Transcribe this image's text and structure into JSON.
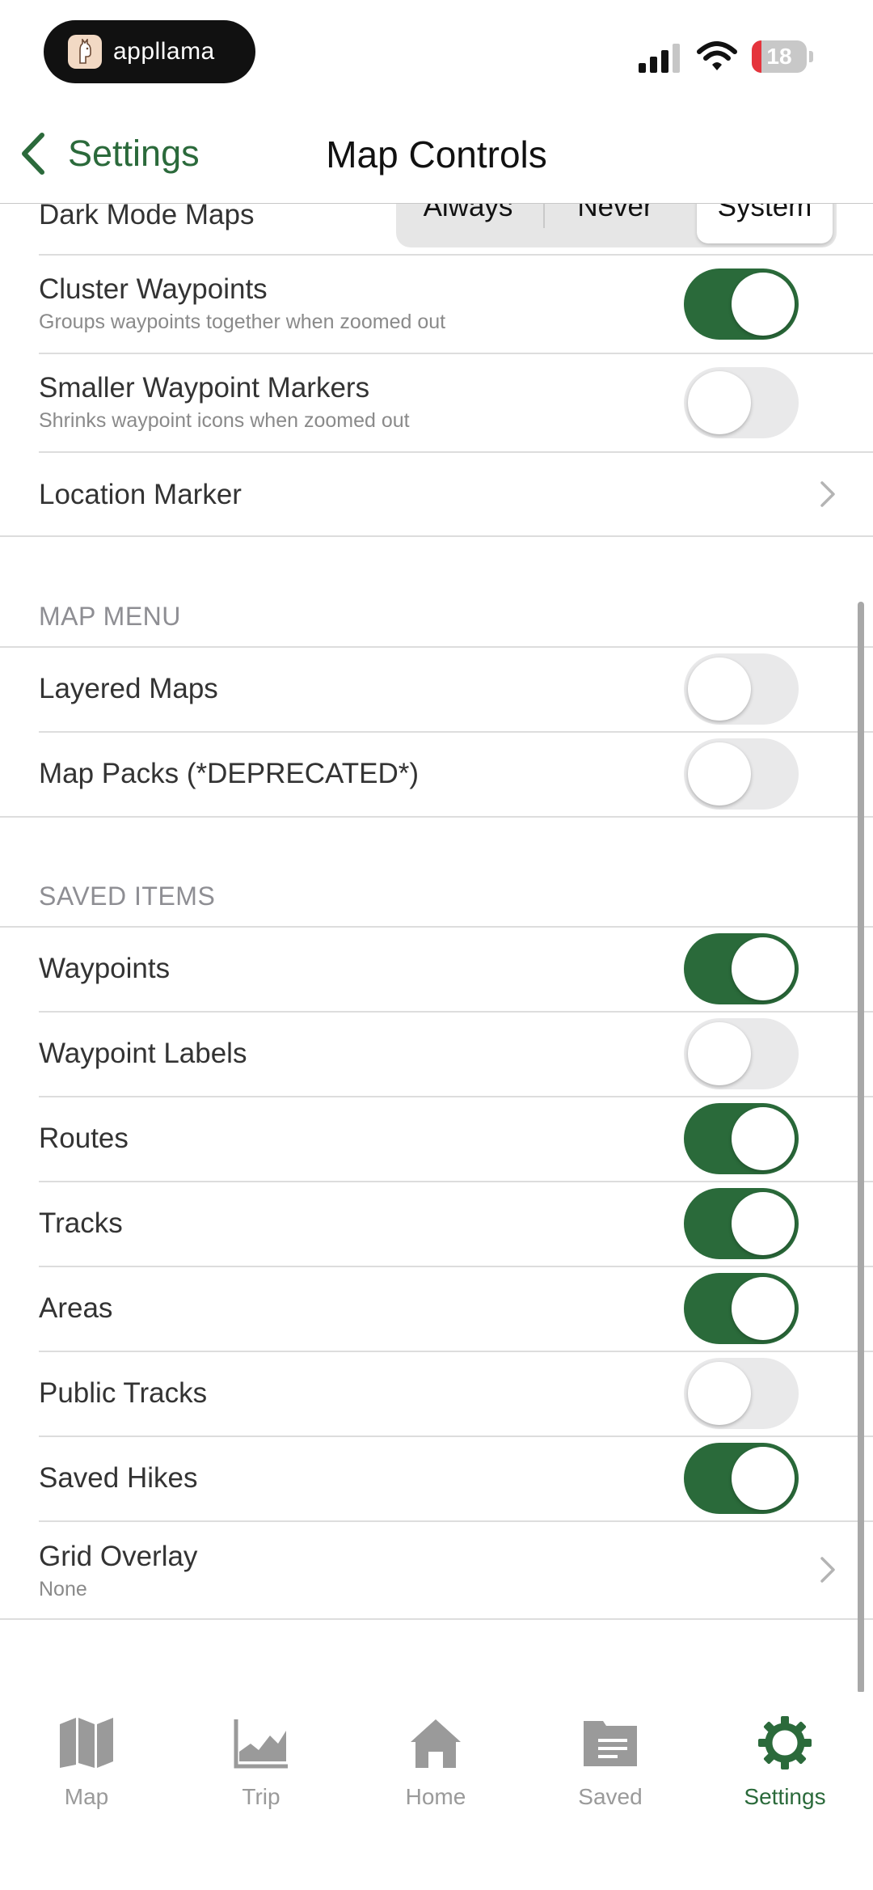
{
  "status_bar": {
    "app_name": "appllama",
    "battery_level": "18",
    "battery_fraction": 0.18
  },
  "nav": {
    "back_label": "Settings",
    "title": "Map Controls"
  },
  "dark_mode": {
    "label": "Dark Mode Maps",
    "options": [
      "Always",
      "Never",
      "System"
    ],
    "selected": "System"
  },
  "top_rows": {
    "cluster": {
      "label": "Cluster Waypoints",
      "sub": "Groups waypoints together when zoomed out",
      "on": true
    },
    "smaller": {
      "label": "Smaller Waypoint Markers",
      "sub": "Shrinks waypoint icons when zoomed out",
      "on": false
    },
    "location_marker": {
      "label": "Location Marker"
    }
  },
  "map_menu": {
    "header": "MAP MENU",
    "items": [
      {
        "label": "Layered Maps",
        "on": false
      },
      {
        "label": "Map Packs (*DEPRECATED*)",
        "on": false
      }
    ]
  },
  "saved_items": {
    "header": "SAVED ITEMS",
    "items": [
      {
        "label": "Waypoints",
        "on": true
      },
      {
        "label": "Waypoint Labels",
        "on": false
      },
      {
        "label": "Routes",
        "on": true
      },
      {
        "label": "Tracks",
        "on": true
      },
      {
        "label": "Areas",
        "on": true
      },
      {
        "label": "Public Tracks",
        "on": false
      },
      {
        "label": "Saved Hikes",
        "on": true
      }
    ],
    "grid_overlay": {
      "label": "Grid Overlay",
      "value": "None"
    }
  },
  "tabs": [
    {
      "label": "Map",
      "icon": "map-icon",
      "active": false
    },
    {
      "label": "Trip",
      "icon": "trip-chart-icon",
      "active": false
    },
    {
      "label": "Home",
      "icon": "home-icon",
      "active": false
    },
    {
      "label": "Saved",
      "icon": "saved-folder-icon",
      "active": false
    },
    {
      "label": "Settings",
      "icon": "settings-gear-icon",
      "active": true
    }
  ],
  "colors": {
    "accent": "#2b6a3b",
    "toggle_on": "#2a6a3a",
    "toggle_off": "#e9e9ea",
    "inactive_tab": "#9a9a9a",
    "battery_low": "#e5343c"
  }
}
